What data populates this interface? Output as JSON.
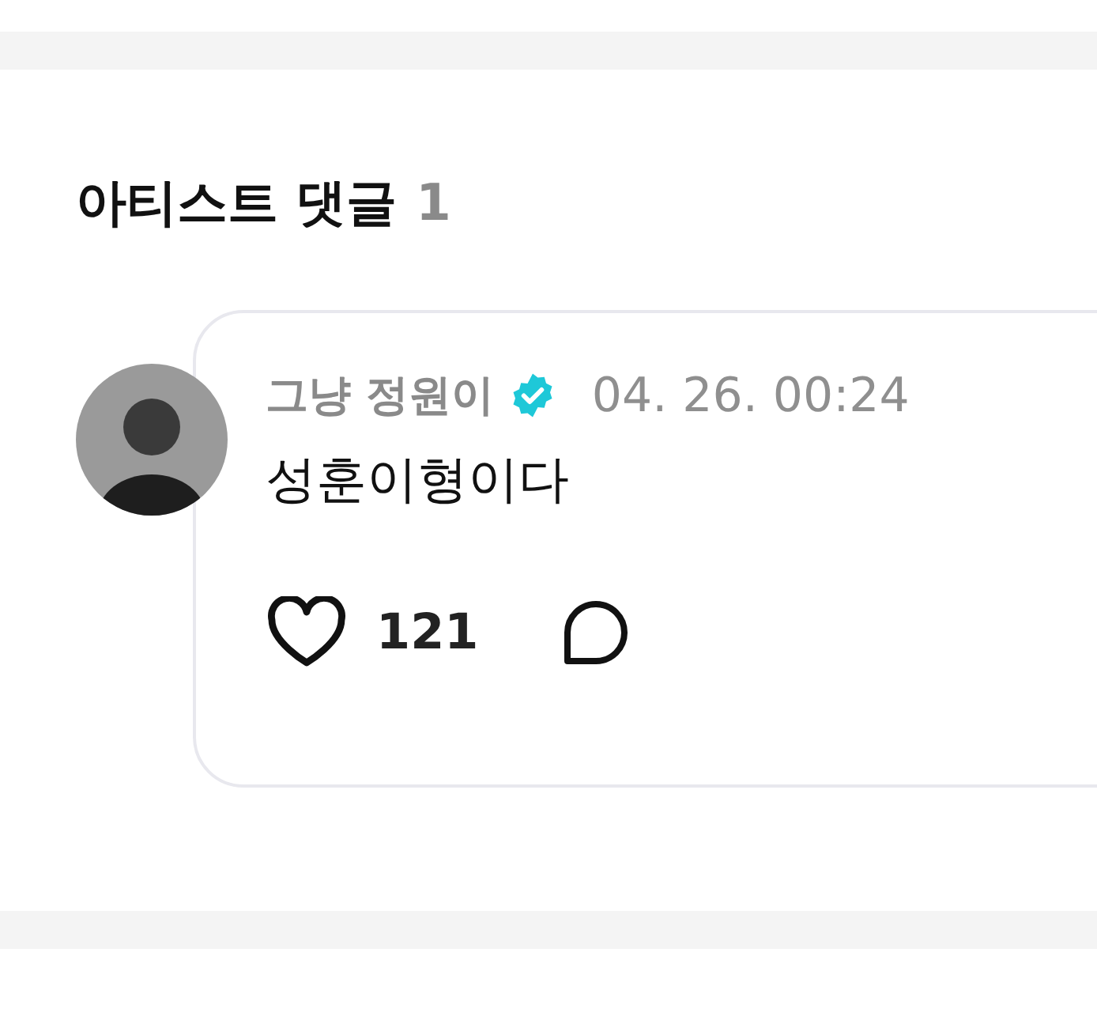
{
  "section": {
    "title": "아티스트 댓글",
    "count": "1"
  },
  "comments": [
    {
      "author": "그냥 정원이",
      "verified": true,
      "time": "04. 26. 00:24",
      "text": "성훈이형이다",
      "likes": "121",
      "liked": false
    }
  ]
}
